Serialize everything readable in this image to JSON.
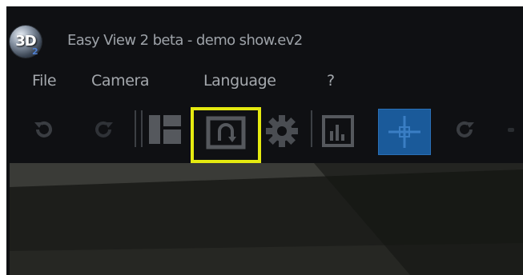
{
  "app": {
    "logo_text": "3D",
    "logo_sub": "2",
    "title": "Easy View 2 beta - demo show.ev2"
  },
  "menu": {
    "items": [
      {
        "label": "File"
      },
      {
        "label": "Camera"
      },
      {
        "label": "Language"
      },
      {
        "label": "?"
      }
    ]
  },
  "toolbar": {
    "icons": [
      {
        "name": "undo-icon"
      },
      {
        "name": "redo-icon"
      },
      {
        "name": "layout-panels-icon"
      },
      {
        "name": "reset-view-icon",
        "highlighted": true
      },
      {
        "name": "settings-gear-icon"
      },
      {
        "name": "bar-chart-icon"
      },
      {
        "name": "move-crosshair-icon",
        "active": true
      },
      {
        "name": "rotate-icon"
      }
    ]
  },
  "colors": {
    "window_bg": "#0f1013",
    "menu_text": "#a4a8ad",
    "highlight": "#e5ea10",
    "active_button": "#1a5a9a",
    "viewport_bg": "#2d2e2a"
  }
}
